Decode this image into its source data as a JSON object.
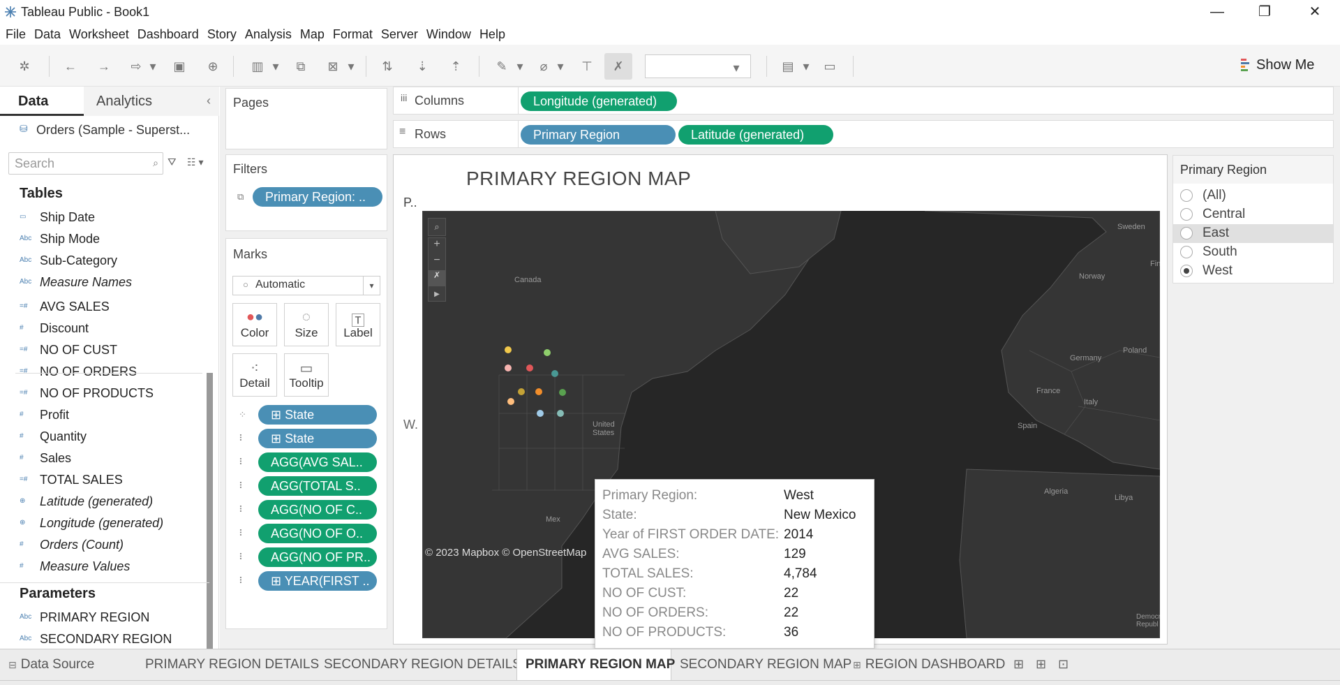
{
  "window": {
    "title": "Tableau Public - Book1",
    "minimize": "—",
    "maximize": "❐",
    "close": "✕"
  },
  "menu": [
    "File",
    "Data",
    "Worksheet",
    "Dashboard",
    "Story",
    "Analysis",
    "Map",
    "Format",
    "Server",
    "Window",
    "Help"
  ],
  "toolbar": {
    "show_me": "Show Me"
  },
  "datapane": {
    "tab_data": "Data",
    "tab_analytics": "Analytics",
    "collapse": "‹",
    "datasource": "Orders (Sample - Superst...",
    "search_placeholder": "Search",
    "tables_header": "Tables",
    "fields": [
      {
        "type": "▭",
        "name": "Ship Date",
        "italic": false
      },
      {
        "type": "Abc",
        "name": "Ship Mode",
        "italic": false
      },
      {
        "type": "Abc",
        "name": "Sub-Category",
        "italic": false
      },
      {
        "type": "Abc",
        "name": "Measure Names",
        "italic": true
      },
      {
        "type": "=#",
        "name": "AVG SALES",
        "italic": false
      },
      {
        "type": "#",
        "name": "Discount",
        "italic": false
      },
      {
        "type": "=#",
        "name": "NO OF CUST",
        "italic": false
      },
      {
        "type": "=#",
        "name": "NO OF ORDERS",
        "italic": false
      },
      {
        "type": "=#",
        "name": "NO OF PRODUCTS",
        "italic": false
      },
      {
        "type": "#",
        "name": "Profit",
        "italic": false
      },
      {
        "type": "#",
        "name": "Quantity",
        "italic": false
      },
      {
        "type": "#",
        "name": "Sales",
        "italic": false
      },
      {
        "type": "=#",
        "name": "TOTAL SALES",
        "italic": false
      },
      {
        "type": "⊕",
        "name": "Latitude (generated)",
        "italic": true
      },
      {
        "type": "⊕",
        "name": "Longitude (generated)",
        "italic": true
      },
      {
        "type": "#",
        "name": "Orders (Count)",
        "italic": true
      },
      {
        "type": "#",
        "name": "Measure Values",
        "italic": true
      }
    ],
    "parameters_header": "Parameters",
    "parameters": [
      {
        "type": "Abc",
        "name": "PRIMARY REGION"
      },
      {
        "type": "Abc",
        "name": "SECONDARY REGION"
      }
    ]
  },
  "pages": {
    "label": "Pages"
  },
  "filters": {
    "label": "Filters",
    "pill": "Primary Region: .."
  },
  "marks": {
    "label": "Marks",
    "type": "Automatic",
    "buttons": [
      "Color",
      "Size",
      "Label",
      "Detail",
      "Tooltip"
    ],
    "pills": [
      {
        "icon": "⁘",
        "text": "⊞  State",
        "color": "blue"
      },
      {
        "icon": "⠇",
        "text": "⊞  State",
        "color": "blue"
      },
      {
        "icon": "⠇",
        "text": "AGG(AVG SAL..",
        "color": "green"
      },
      {
        "icon": "⠇",
        "text": "AGG(TOTAL S..",
        "color": "green"
      },
      {
        "icon": "⠇",
        "text": "AGG(NO OF C..",
        "color": "green"
      },
      {
        "icon": "⠇",
        "text": "AGG(NO OF O..",
        "color": "green"
      },
      {
        "icon": "⠇",
        "text": "AGG(NO OF PR..",
        "color": "green"
      },
      {
        "icon": "⠇",
        "text": "⊞  YEAR(FIRST ..",
        "color": "blue"
      }
    ]
  },
  "shelves": {
    "columns_label": "Columns",
    "rows_label": "Rows",
    "columns_pills": [
      "Longitude (generated)"
    ],
    "rows_pills": [
      "Primary Region",
      "Latitude (generated)"
    ]
  },
  "view": {
    "title": "PRIMARY REGION MAP",
    "row_header_top": "P..",
    "row_header_side": "W.",
    "attribution": "© 2023 Mapbox © OpenStreetMap",
    "map_labels": [
      "Canada",
      "United States",
      "Mex",
      "Sweden",
      "Norway",
      "Fin",
      "Germany",
      "Poland",
      "France",
      "Italy",
      "Spain",
      "Algeria",
      "Libya",
      "Democra Republ"
    ]
  },
  "tooltip": {
    "rows": [
      {
        "label": "Primary Region:",
        "value": "West"
      },
      {
        "label": "State:",
        "value": "New Mexico"
      },
      {
        "label": "Year of FIRST ORDER DATE:",
        "value": "2014"
      },
      {
        "label": "AVG SALES:",
        "value": "129"
      },
      {
        "label": "TOTAL SALES:",
        "value": "4,784"
      },
      {
        "label": "NO OF CUST:",
        "value": "22"
      },
      {
        "label": "NO OF ORDERS:",
        "value": "22"
      },
      {
        "label": "NO OF PRODUCTS:",
        "value": "36"
      }
    ]
  },
  "filter_card": {
    "title": "Primary Region",
    "options": [
      "(All)",
      "Central",
      "East",
      "South",
      "West"
    ],
    "selected": "West",
    "hovered": "East"
  },
  "sheet_tabs": [
    {
      "label": "Data Source",
      "icon": "⊟"
    },
    {
      "label": "PRIMARY REGION DETAILS"
    },
    {
      "label": "SECONDARY REGION DETAILS"
    },
    {
      "label": "PRIMARY REGION MAP",
      "active": true
    },
    {
      "label": "SECONDARY REGION MAP"
    },
    {
      "label": "REGION DASHBOARD",
      "icon": "⊞"
    }
  ],
  "colors": {
    "pill_blue": "#4a8fb5",
    "pill_green": "#11a06f",
    "map_bg": "#262626"
  }
}
